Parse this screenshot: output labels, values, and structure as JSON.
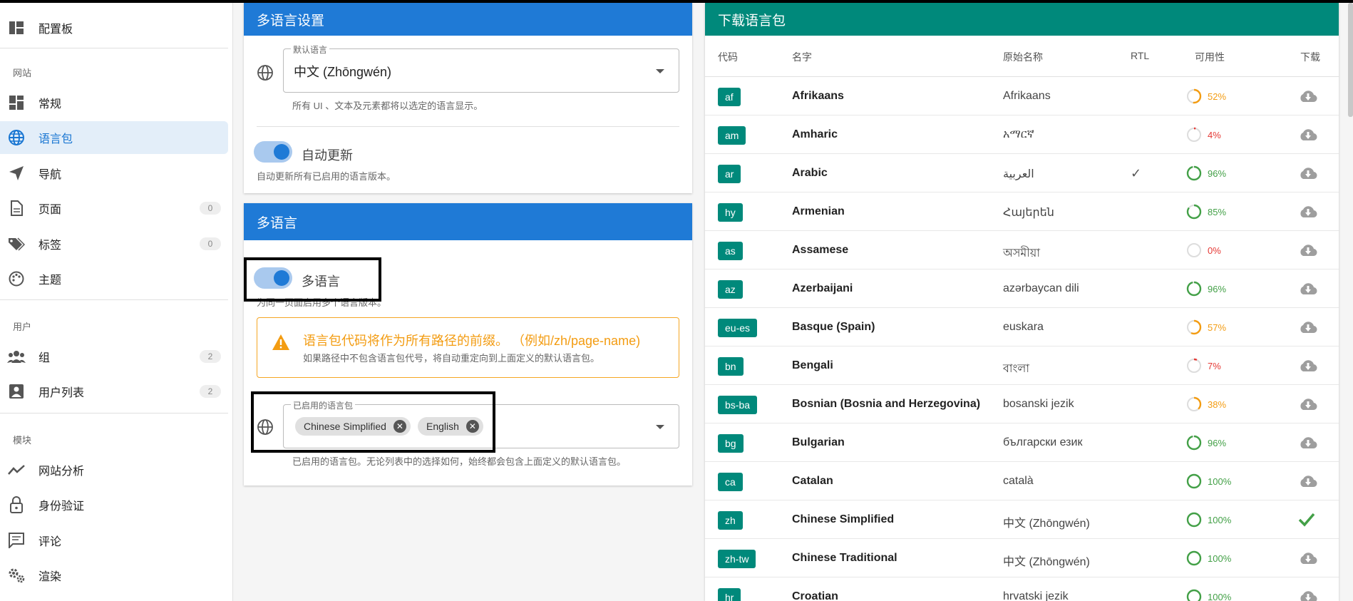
{
  "sidebar": {
    "dashboard": "配置板",
    "section_site": "网站",
    "items_site": [
      {
        "label": "常规",
        "icon": "dashboard-icon"
      },
      {
        "label": "语言包",
        "icon": "globe-icon",
        "active": true
      },
      {
        "label": "导航",
        "icon": "navigation-icon"
      },
      {
        "label": "页面",
        "icon": "page-icon",
        "count": "0"
      },
      {
        "label": "标签",
        "icon": "tag-icon",
        "count": "0"
      },
      {
        "label": "主题",
        "icon": "palette-icon"
      }
    ],
    "section_users": "用户",
    "items_users": [
      {
        "label": "组",
        "icon": "group-icon",
        "count": "2"
      },
      {
        "label": "用户列表",
        "icon": "user-list-icon",
        "count": "2"
      }
    ],
    "section_modules": "模块",
    "items_modules": [
      {
        "label": "网站分析",
        "icon": "analytics-icon"
      },
      {
        "label": "身份验证",
        "icon": "lock-icon"
      },
      {
        "label": "评论",
        "icon": "comment-icon"
      },
      {
        "label": "渲染",
        "icon": "gears-icon"
      }
    ]
  },
  "settings_card": {
    "title": "多语言设置",
    "default_language_legend": "默认语言",
    "default_language_value": "中文 (Zhōngwén)",
    "default_language_hint": "所有 UI 、文本及元素都将以选定的语言显示。",
    "auto_update_label": "自动更新",
    "auto_update_hint": "自动更新所有已启用的语言版本。"
  },
  "multilang_card": {
    "title": "多语言",
    "toggle_label": "多语言",
    "toggle_hint": "为同一页面启用多个语言版本。",
    "alert_title": "语言包代码将作为所有路径的前缀。 （例如/zh/page-name)",
    "alert_sub": "如果路径中不包含语言包代号，将自动重定向到上面定义的默认语言包。",
    "enabled_legend": "已启用的语言包",
    "chips": [
      "Chinese Simplified",
      "English"
    ],
    "enabled_hint": "已启用的语言包。无论列表中的选择如何，始终都会包含上面定义的默认语言包。"
  },
  "download_card": {
    "title": "下载语言包",
    "headers": {
      "code": "代码",
      "name": "名字",
      "native": "原始名称",
      "rtl": "RTL",
      "availability": "可用性",
      "download": "下载"
    },
    "rows": [
      {
        "code": "af",
        "name": "Afrikaans",
        "native": "Afrikaans",
        "rtl": "",
        "pct": "52%",
        "value": 52,
        "color": "#f39c12",
        "installed": false
      },
      {
        "code": "am",
        "name": "Amharic",
        "native": "አማርኛ",
        "rtl": "",
        "pct": "4%",
        "value": 4,
        "color": "#e53935",
        "installed": false
      },
      {
        "code": "ar",
        "name": "Arabic",
        "native": "العربية",
        "rtl": "✓",
        "pct": "96%",
        "value": 96,
        "color": "#43a047",
        "installed": false
      },
      {
        "code": "hy",
        "name": "Armenian",
        "native": "Հայերեն",
        "rtl": "",
        "pct": "85%",
        "value": 85,
        "color": "#43a047",
        "installed": false
      },
      {
        "code": "as",
        "name": "Assamese",
        "native": "অসমীয়া",
        "rtl": "",
        "pct": "0%",
        "value": 0,
        "color": "#e53935",
        "installed": false
      },
      {
        "code": "az",
        "name": "Azerbaijani",
        "native": "azərbaycan dili",
        "rtl": "",
        "pct": "96%",
        "value": 96,
        "color": "#43a047",
        "installed": false
      },
      {
        "code": "eu-es",
        "name": "Basque (Spain)",
        "native": "euskara",
        "rtl": "",
        "pct": "57%",
        "value": 57,
        "color": "#f39c12",
        "installed": false
      },
      {
        "code": "bn",
        "name": "Bengali",
        "native": "বাংলা",
        "rtl": "",
        "pct": "7%",
        "value": 7,
        "color": "#e53935",
        "installed": false
      },
      {
        "code": "bs-ba",
        "name": "Bosnian (Bosnia and Herzegovina)",
        "native": "bosanski jezik",
        "rtl": "",
        "pct": "38%",
        "value": 38,
        "color": "#f39c12",
        "installed": false
      },
      {
        "code": "bg",
        "name": "Bulgarian",
        "native": "български език",
        "rtl": "",
        "pct": "96%",
        "value": 96,
        "color": "#43a047",
        "installed": false
      },
      {
        "code": "ca",
        "name": "Catalan",
        "native": "català",
        "rtl": "",
        "pct": "100%",
        "value": 100,
        "color": "#43a047",
        "installed": false
      },
      {
        "code": "zh",
        "name": "Chinese Simplified",
        "native": "中文 (Zhōngwén)",
        "rtl": "",
        "pct": "100%",
        "value": 100,
        "color": "#43a047",
        "installed": true
      },
      {
        "code": "zh-tw",
        "name": "Chinese Traditional",
        "native": "中文 (Zhōngwén)",
        "rtl": "",
        "pct": "100%",
        "value": 100,
        "color": "#43a047",
        "installed": false
      },
      {
        "code": "hr",
        "name": "Croatian",
        "native": "hrvatski jezik",
        "rtl": "",
        "pct": "100%",
        "value": 100,
        "color": "#43a047",
        "installed": false
      }
    ]
  }
}
